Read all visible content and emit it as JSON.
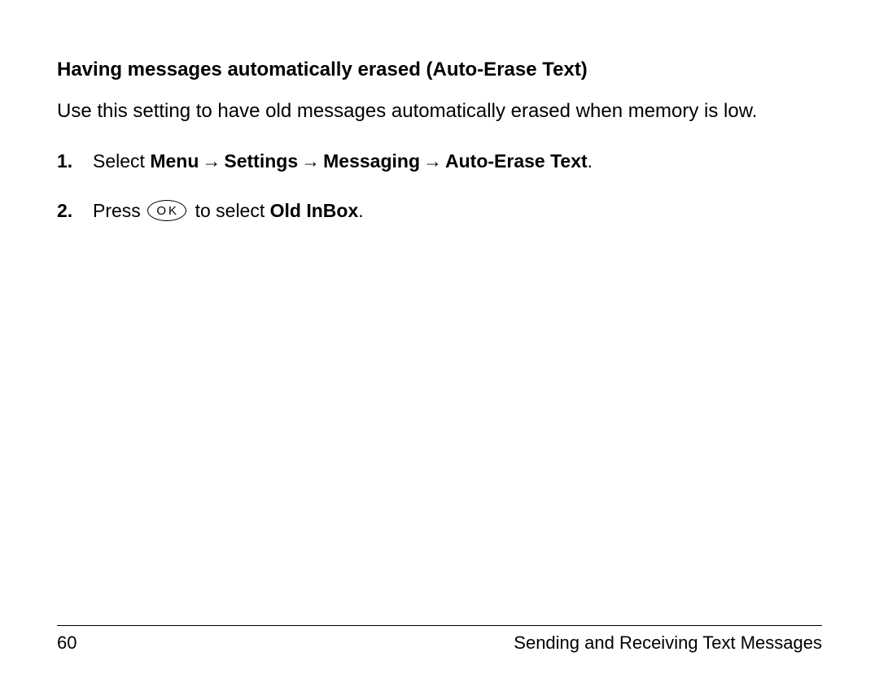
{
  "heading": "Having messages automatically erased (Auto-Erase Text)",
  "intro": "Use this setting to have old messages automatically erased when memory is low.",
  "arrow": "→",
  "step1": {
    "num": "1.",
    "t1": "Select ",
    "menu": "Menu",
    "settings": "Settings",
    "messaging": "Messaging",
    "autoerase": "Auto-Erase Text",
    "dot": "."
  },
  "step2": {
    "num": "2.",
    "press": "Press ",
    "ok": "OK",
    "mid": " to select ",
    "target": "Old InBox",
    "dot": "."
  },
  "footer": {
    "page": "60",
    "section": "Sending and Receiving Text Messages"
  }
}
